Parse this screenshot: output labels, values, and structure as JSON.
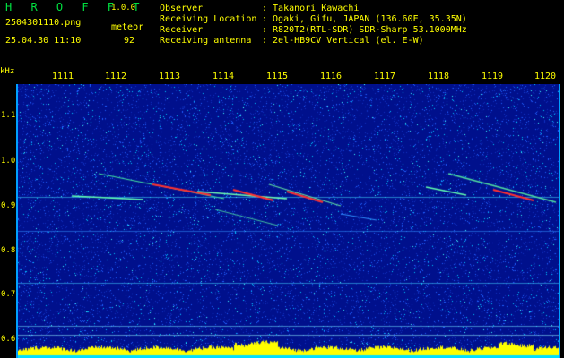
{
  "header": {
    "app_title": "H R O F F T",
    "version": "1.0.0",
    "filename": "2504301110.png",
    "datetime": "25.04.30 11:10",
    "meteor_label": "meteor",
    "meteor_count": "92"
  },
  "info": [
    {
      "label": "Observer",
      "value": ": Takanori Kawachi"
    },
    {
      "label": "Receiving Location",
      "value": ": Ogaki, Gifu, JAPAN (136.60E, 35.35N)"
    },
    {
      "label": "Receiver",
      "value": ": R820T2(RTL-SDR) SDR-Sharp 53.1000MHz"
    },
    {
      "label": "Receiving antenna",
      "value": ": 2el-HB9CV Vertical (el. E-W)"
    }
  ],
  "axis": {
    "unit": "kHz",
    "y_ticks": [
      "1.1",
      "1.0",
      "0.9",
      "0.8",
      "0.7",
      "0.6"
    ],
    "x_ticks": [
      "1111",
      "1112",
      "1113",
      "1114",
      "1115",
      "1116",
      "1117",
      "1118",
      "1119",
      "1120"
    ]
  },
  "colors": {
    "background": "#000000",
    "label_yellow": "#ffff00",
    "title_green": "#00e040",
    "spectrogram_base": "#00108c",
    "noise_cyan": "#00c8ff",
    "meteor_red": "#ff3030",
    "baseline_yellow": "#ffff00"
  }
}
